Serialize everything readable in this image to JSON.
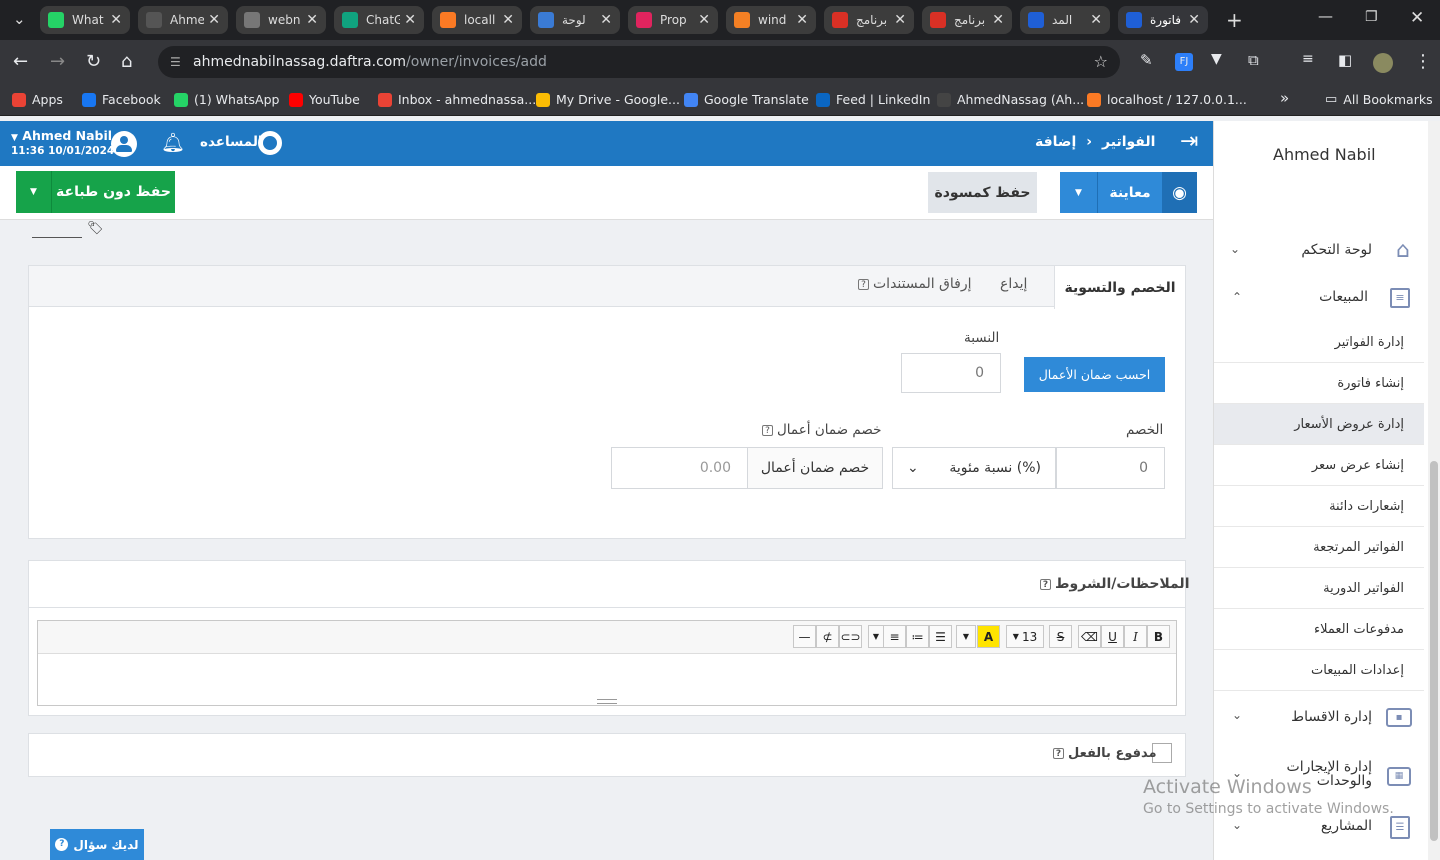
{
  "browser": {
    "tabs": [
      {
        "title": "What",
        "icon": "whatsapp-icon",
        "color": "#25d366"
      },
      {
        "title": "Ahme",
        "icon": "github-icon",
        "color": "#555555"
      },
      {
        "title": "webn",
        "icon": "globe-icon",
        "color": "#777777"
      },
      {
        "title": "ChatG",
        "icon": "chatgpt-icon",
        "color": "#10a37f"
      },
      {
        "title": "locall",
        "icon": "xampp-icon",
        "color": "#fb7a24"
      },
      {
        "title": "لوحة",
        "icon": "dashboard-icon",
        "color": "#3a7bd5"
      },
      {
        "title": "Prop",
        "icon": "pin-icon",
        "color": "#e0245e"
      },
      {
        "title": "wind",
        "icon": "stack-icon",
        "color": "#f48024"
      },
      {
        "title": "برنامج",
        "icon": "play-icon",
        "color": "#d93025"
      },
      {
        "title": "برنامج",
        "icon": "play-icon",
        "color": "#d93025"
      },
      {
        "title": "المد",
        "icon": "daftra-icon",
        "color": "#1f5fd6"
      },
      {
        "title": "فاتورة",
        "icon": "daftra-icon",
        "color": "#1f5fd6"
      }
    ],
    "url_host": "ahmednabilnassag.daftra.com",
    "url_path": "/owner/invoices/add",
    "bookmarks": [
      {
        "label": "Apps",
        "color": "#ea4335"
      },
      {
        "label": "Facebook",
        "color": "#1877f2"
      },
      {
        "label": "(1) WhatsApp",
        "color": "#25d366"
      },
      {
        "label": "YouTube",
        "color": "#ff0000"
      },
      {
        "label": "Inbox - ahmednassa...",
        "color": "#ea4335"
      },
      {
        "label": "My Drive - Google...",
        "color": "#fbbc04"
      },
      {
        "label": "Google Translate",
        "color": "#4285f4"
      },
      {
        "label": "Feed | LinkedIn",
        "color": "#0a66c2"
      },
      {
        "label": "AhmedNassag (Ah...",
        "color": "#444444"
      },
      {
        "label": "localhost / 127.0.0.1...",
        "color": "#fb7a24"
      }
    ],
    "all_bookmarks": "All Bookmarks"
  },
  "header": {
    "user_name": "Ahmed Nabil",
    "datetime": "11:36 10/01/2024",
    "help": "المساعده",
    "breadcrumb_parent": "الفواتير",
    "breadcrumb_current": "إضافة"
  },
  "actions": {
    "save_no_print": "حفظ دون طباعة",
    "save_draft": "حفظ كمسودة",
    "preview": "معاينة"
  },
  "tabs": {
    "discount": "الخصم والتسوية",
    "deposit": "إيداع",
    "attach": "إرفاق المستندات"
  },
  "discount_form": {
    "ratio_label": "النسبة",
    "ratio_value": "0",
    "calc_button": "احسب ضمان الأعمال",
    "discount_label": "الخصم",
    "discount_value": "0",
    "discount_type": "نسبة مئوية (%)",
    "warranty_label": "خصم ضمان أعمال",
    "warranty_button": "خصم ضمان أعمال",
    "warranty_value": "0.00"
  },
  "notes": {
    "title": "الملاحظات/الشروط",
    "font_size": "13"
  },
  "paid": {
    "label": "مدفوع بالفعل"
  },
  "sidebar": {
    "user": "Ahmed Nabil",
    "dashboard": "لوحة التحكم",
    "sales": "المبيعات",
    "sub_items": [
      "إدارة الفواتير",
      "إنشاء فاتورة",
      "إدارة عروض الأسعار",
      "إنشاء عرض سعر",
      "إشعارات دائنة",
      "الفواتير المرتجعة",
      "الفواتير الدورية",
      "مدفوعات العملاء",
      "إعدادات المبيعات"
    ],
    "installments": "إدارة الاقساط",
    "rentals_line1": "إدارة الإيجارات",
    "rentals_line2": "والوحدات",
    "projects": "المشاريع"
  },
  "watermark": {
    "line1": "Activate Windows",
    "line2": "Go to Settings to activate Windows."
  },
  "help_button": "لديك سؤال"
}
